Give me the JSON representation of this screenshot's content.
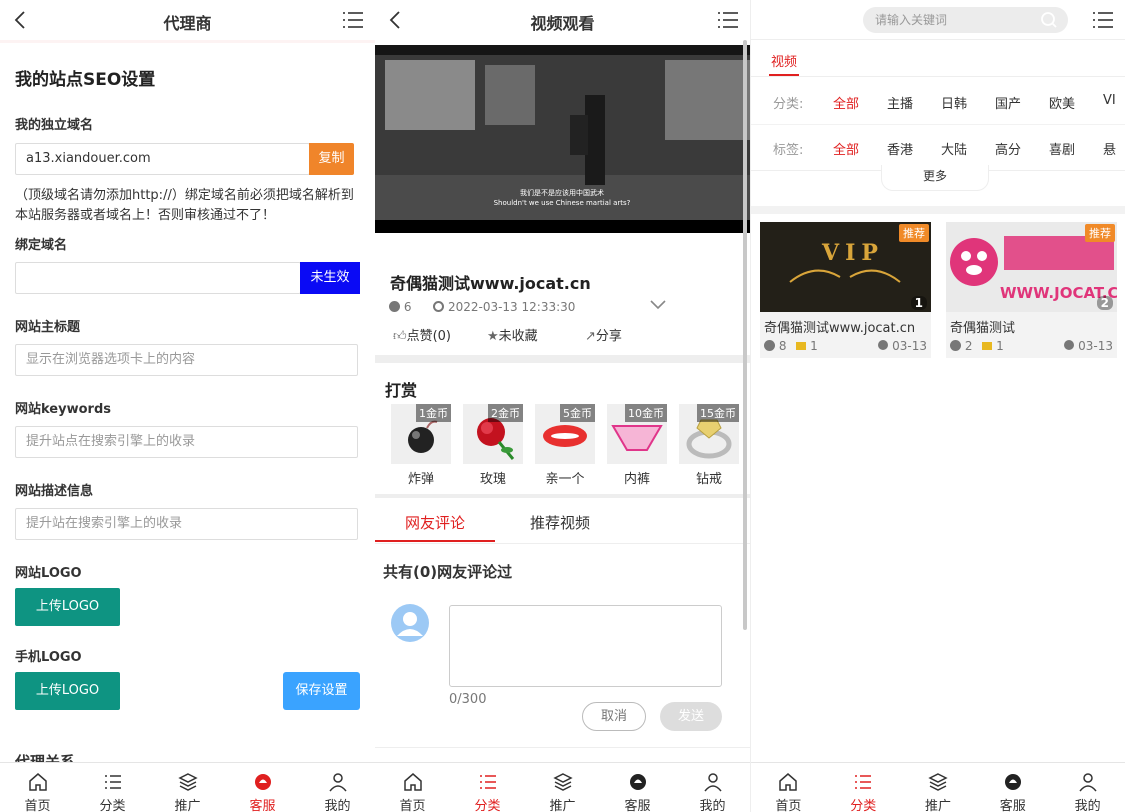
{
  "screen1": {
    "header_title": "代理商",
    "heading": "我的站点SEO设置",
    "domain_label": "我的独立域名",
    "domain_value": "a13.xiandouer.com",
    "copy_button": "复制",
    "domain_note": "（顶级域名请勿添加http://）绑定域名前必须把域名解析到本站服务器或者域名上！否则审核通过不了！",
    "bind_label": "绑定域名",
    "bind_status": "未生效",
    "title_label": "网站主标题",
    "title_placeholder": "显示在浏览器选项卡上的内容",
    "keywords_label": "网站keywords",
    "keywords_placeholder": "提升站点在搜索引擎上的收录",
    "desc_label": "网站描述信息",
    "desc_placeholder": "提升站在搜索引擎上的收录",
    "logo_label": "网站LOGO",
    "logo_button": "上传LOGO",
    "mobile_logo_label": "手机LOGO",
    "mobile_logo_button": "上传LOGO",
    "save_button": "保存设置",
    "partial_heading": "代理关系"
  },
  "screen2": {
    "header_title": "视频观看",
    "subtitle_cn": "我们是不是应该用中国武术",
    "subtitle_en": "Shouldn't we use Chinese martial arts?",
    "video_title": "奇偶猫测试www.jocat.cn",
    "plays": "6",
    "date": "2022-03-13 12:33:30",
    "like": "点赞(0)",
    "favorite": "未收藏",
    "share": "分享",
    "reward_title": "打赏",
    "gifts": [
      {
        "name": "炸弹",
        "price": "1金币"
      },
      {
        "name": "玫瑰",
        "price": "2金币"
      },
      {
        "name": "亲一个",
        "price": "5金币"
      },
      {
        "name": "内裤",
        "price": "10金币"
      },
      {
        "name": "钻戒",
        "price": "15金币"
      }
    ],
    "tab_comments": "网友评论",
    "tab_recommend": "推荐视频",
    "comments_count": "共有(0)网友评论过",
    "char_count": "0/300",
    "cancel_button": "取消",
    "send_button": "发送"
  },
  "screen3": {
    "search_placeholder": "请输入关键词",
    "section_tab": "视频",
    "cat_label": "分类:",
    "categories": [
      "全部",
      "主播",
      "日韩",
      "国产",
      "欧美",
      "VI"
    ],
    "tag_label": "标签:",
    "tags": [
      "全部",
      "香港",
      "大陆",
      "高分",
      "喜剧",
      "悬"
    ],
    "more": "更多",
    "cards": [
      {
        "title": "奇偶猫测试www.jocat.cn",
        "badge": "推荐",
        "index": "1",
        "plays": "8",
        "coins": "1",
        "date": "03-13",
        "thumb_text": "VIP"
      },
      {
        "title": "奇偶猫测试",
        "badge": "推荐",
        "index": "2",
        "plays": "2",
        "coins": "1",
        "date": "03-13",
        "thumb_text": "WWW.JOCAT.C"
      }
    ]
  },
  "tabbar": [
    "首页",
    "分类",
    "推广",
    "客服",
    "我的"
  ],
  "colors": {
    "accent_red": "#e02020",
    "orange": "#f0852a",
    "green": "#0e9482",
    "blue": "#0a0af5",
    "sky": "#3aa3ff"
  }
}
